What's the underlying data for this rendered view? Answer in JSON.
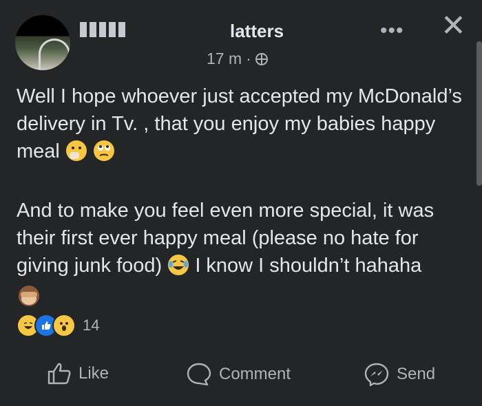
{
  "post": {
    "author_visible_suffix": "latters",
    "time": "17 m",
    "separator": "·",
    "paragraphs": [
      "Well I hope whoever just accepted my McDonald’s delivery in Tv. , that you enjoy my babies happy meal",
      "And to make you feel even more special, it was their first ever happy meal (please no hate for giving junk food)",
      "I know I shouldn’t hahaha"
    ],
    "reactions_count": "14"
  },
  "header": {
    "more_label": "•••",
    "close_label": "✕"
  },
  "actions": {
    "like_label": "Like",
    "comment_label": "Comment",
    "send_label": "Send"
  },
  "icons": {
    "globe": "globe-icon",
    "like": "thumbs-up-icon",
    "comment": "speech-bubble-icon",
    "send": "messenger-icon"
  },
  "colors": {
    "background": "#242526",
    "primary_text": "#e4e6eb",
    "secondary_text": "#b0b3b8",
    "like_blue": "#1b74e4",
    "emoji_yellow": "#f7c744"
  }
}
